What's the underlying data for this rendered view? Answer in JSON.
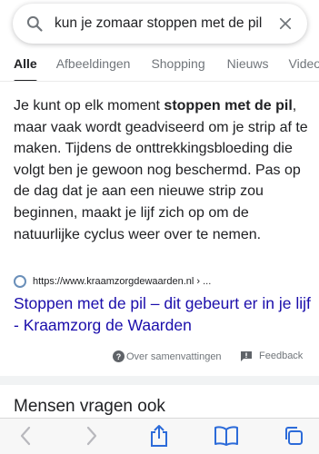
{
  "search": {
    "query": "kun je zomaar stoppen met de pil",
    "search_icon": "search-icon",
    "clear_icon": "close-icon"
  },
  "tabs": [
    {
      "label": "Alle",
      "active": true
    },
    {
      "label": "Afbeeldingen",
      "active": false
    },
    {
      "label": "Shopping",
      "active": false
    },
    {
      "label": "Nieuws",
      "active": false
    },
    {
      "label": "Video's",
      "active": false
    }
  ],
  "snippet": {
    "part1": "Je kunt op elk moment ",
    "bold": "stoppen met de pil",
    "part2": ", maar vaak wordt geadviseerd om je strip af te maken. Tijdens de onttrekkingsbloeding die volgt ben je gewoon nog beschermd. Pas op de dag dat je aan een nieuwe strip zou beginnen, maakt je lijf zich op om de natuurlijke cyclus weer over te nemen."
  },
  "source": {
    "url": "https://www.kraamzorgdewaarden.nl › ...",
    "title": "Stoppen met de pil – dit gebeurt er in je lijf - Kraamzorg de Waarden"
  },
  "footer": {
    "about_label": "Over samenvattingen",
    "feedback_label": "Feedback"
  },
  "paa": {
    "title": "Mensen vragen ook"
  },
  "colors": {
    "link": "#1a0dab",
    "text": "#202124",
    "muted": "#70757a"
  }
}
